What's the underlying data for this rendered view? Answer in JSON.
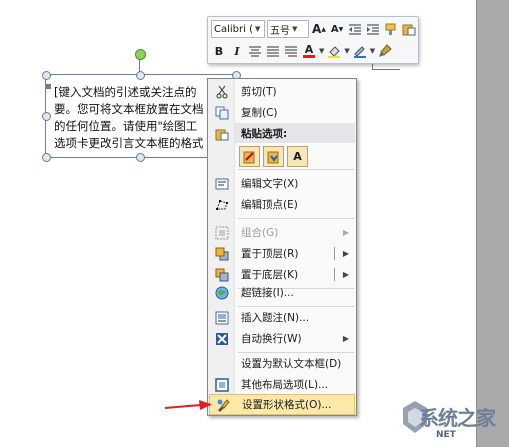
{
  "mini_toolbar": {
    "font_name": "Calibri (",
    "font_size": "五号",
    "row1_buttons": [
      "grow-font-icon",
      "shrink-font-icon",
      "decrease-indent-icon",
      "increase-indent-icon",
      "format-painter-icon",
      "paste-icon"
    ],
    "bold": "B",
    "italic": "I",
    "font_color_letter": "A",
    "font_color": "#e0201b",
    "fill_color": "#f4e026"
  },
  "textbox": {
    "lines": [
      "[键入文档的引述或关注点的",
      "要。您可将文本框放置在文档",
      "的任何位置。请使用\"绘图工",
      "选项卡更改引言文本框的格式"
    ]
  },
  "context_menu": {
    "paste_options_header": "粘贴选项:",
    "items": [
      {
        "icon": "scissors-icon",
        "label": "剪切(T)",
        "enabled": true
      },
      {
        "icon": "copy-icon",
        "label": "复制(C)",
        "enabled": true
      },
      {
        "icon": "edit-text-icon",
        "label": "编辑文字(X)",
        "enabled": true
      },
      {
        "icon": "edit-points-icon",
        "label": "编辑顶点(E)",
        "enabled": true
      },
      {
        "icon": "group-icon",
        "label": "组合(G)",
        "enabled": false
      },
      {
        "icon": "bring-to-front-icon",
        "label": "置于顶层(R)",
        "enabled": true
      },
      {
        "icon": "send-to-back-icon",
        "label": "置于底层(K)",
        "enabled": true
      },
      {
        "icon": "hyperlink-icon",
        "label": "超链接(I)...",
        "enabled": true
      },
      {
        "icon": "insert-caption-icon",
        "label": "插入题注(N)...",
        "enabled": true
      },
      {
        "icon": "text-wrap-icon",
        "label": "自动换行(W)",
        "enabled": true
      },
      {
        "icon": "",
        "label": "设置为默认文本框(D)",
        "enabled": true
      },
      {
        "icon": "layout-options-icon",
        "label": "其他布局选项(L)...",
        "enabled": true
      },
      {
        "icon": "format-shape-icon",
        "label": "设置形状格式(O)...",
        "enabled": true,
        "highlighted": true
      }
    ]
  },
  "watermark": {
    "text": "系统之家",
    "url": "NET"
  },
  "colors": {
    "highlight": "#fce9a8",
    "arrow": "#e02020"
  }
}
